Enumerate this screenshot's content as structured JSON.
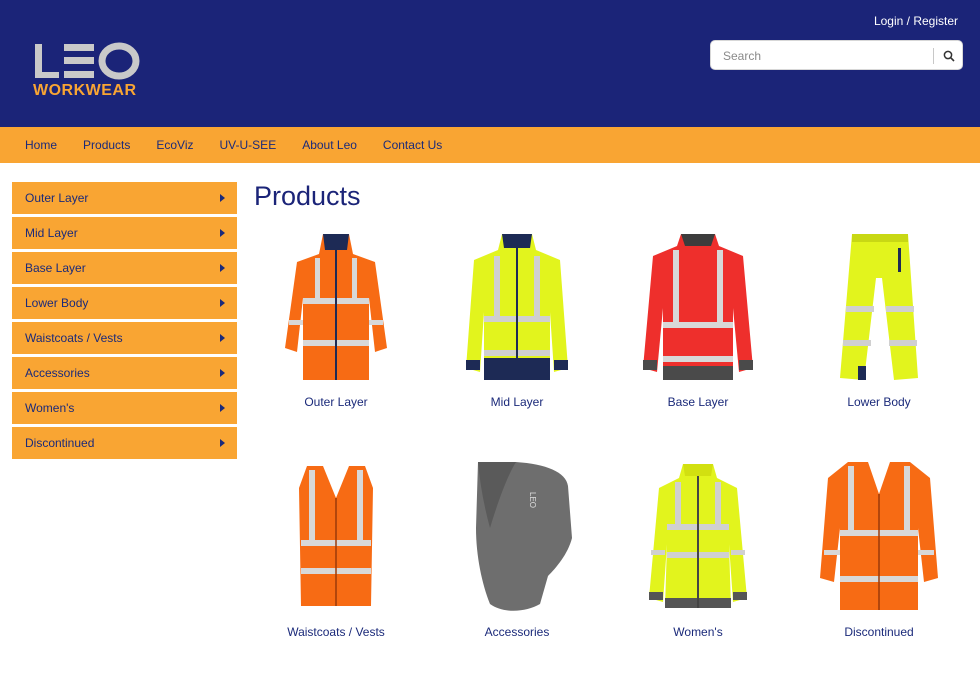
{
  "header": {
    "login_label": "Login / Register",
    "logo_text": "LEO",
    "logo_subtext": "WORKWEAR",
    "search": {
      "placeholder": "Search",
      "value": ""
    }
  },
  "nav": {
    "items": [
      {
        "label": "Home"
      },
      {
        "label": "Products"
      },
      {
        "label": "EcoViz"
      },
      {
        "label": "UV-U-SEE"
      },
      {
        "label": "About Leo"
      },
      {
        "label": "Contact Us"
      }
    ]
  },
  "sidebar": {
    "items": [
      {
        "label": "Outer Layer"
      },
      {
        "label": "Mid Layer"
      },
      {
        "label": "Base Layer"
      },
      {
        "label": "Lower Body"
      },
      {
        "label": "Waistcoats / Vests"
      },
      {
        "label": "Accessories"
      },
      {
        "label": "Women's"
      },
      {
        "label": "Discontinued"
      }
    ]
  },
  "main": {
    "title": "Products",
    "products": [
      {
        "label": "Outer Layer",
        "icon": "orange-jacket-icon"
      },
      {
        "label": "Mid Layer",
        "icon": "yellow-softshell-icon"
      },
      {
        "label": "Base Layer",
        "icon": "red-polo-icon"
      },
      {
        "label": "Lower Body",
        "icon": "yellow-trousers-icon"
      },
      {
        "label": "Waistcoats / Vests",
        "icon": "orange-vest-icon"
      },
      {
        "label": "Accessories",
        "icon": "grey-snood-icon"
      },
      {
        "label": "Women's",
        "icon": "yellow-womens-jacket-icon"
      },
      {
        "label": "Discontinued",
        "icon": "orange-sleeved-vest-icon"
      }
    ]
  },
  "colors": {
    "header_bg": "#1b2478",
    "accent": "#f9a533",
    "text": "#1b2a7a",
    "hiviz_orange": "#f76b14",
    "hiviz_yellow": "#e2f41d",
    "red": "#ee2f2c",
    "navy": "#1d2a55",
    "grey": "#6e6e6e"
  }
}
